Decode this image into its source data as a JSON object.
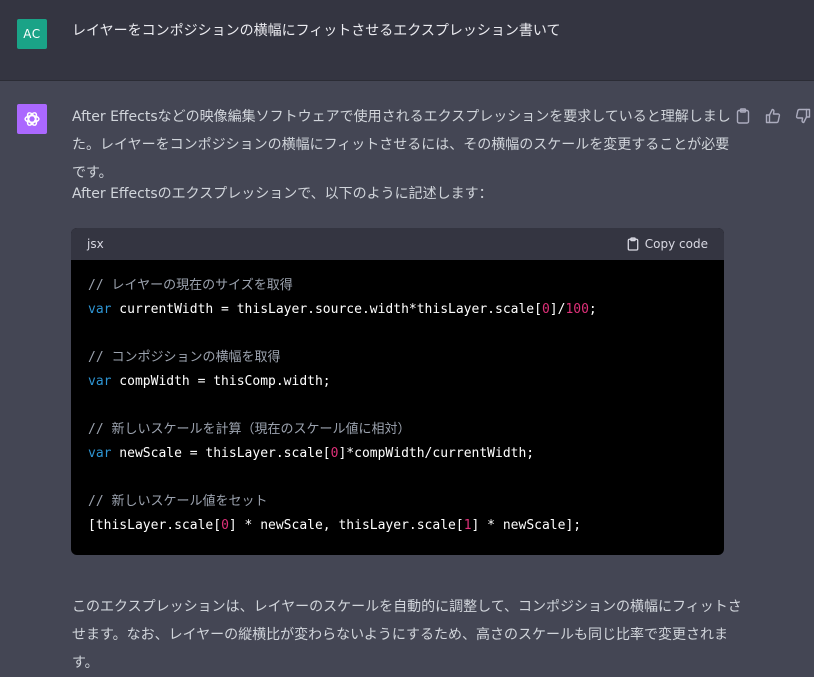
{
  "user": {
    "avatar_initials": "AC",
    "message": "レイヤーをコンポジションの横幅にフィットさせるエクスプレッション書いて"
  },
  "assistant": {
    "paragraph1": "After Effectsなどの映像編集ソフトウェアで使用されるエクスプレッションを要求していると理解しました。レイヤーをコンポジションの横幅にフィットさせるには、その横幅のスケールを変更することが必要です。",
    "paragraph2": "After Effectsのエクスプレッションで、以下のように記述します：",
    "paragraph3": "このエクスプレッションは、レイヤーのスケールを自動的に調整して、コンポジションの横幅にフィットさせます。なお、レイヤーの縦横比が変わらないようにするため、高さのスケールも同じ比率で変更されます。",
    "code": {
      "language": "jsx",
      "copy_label": "Copy code",
      "lines": [
        [
          {
            "t": "cm",
            "v": "// レイヤーの現在のサイズを取得"
          }
        ],
        [
          {
            "t": "kw",
            "v": "var"
          },
          {
            "t": "",
            "v": " currentWidth = thisLayer.source.width*thisLayer.scale["
          },
          {
            "t": "num",
            "v": "0"
          },
          {
            "t": "",
            "v": "]/"
          },
          {
            "t": "num",
            "v": "100"
          },
          {
            "t": "",
            "v": ";"
          }
        ],
        [],
        [
          {
            "t": "cm",
            "v": "// コンポジションの横幅を取得"
          }
        ],
        [
          {
            "t": "kw",
            "v": "var"
          },
          {
            "t": "",
            "v": " compWidth = thisComp.width;"
          }
        ],
        [],
        [
          {
            "t": "cm",
            "v": "// 新しいスケールを計算（現在のスケール値に相対）"
          }
        ],
        [
          {
            "t": "kw",
            "v": "var"
          },
          {
            "t": "",
            "v": " newScale = thisLayer.scale["
          },
          {
            "t": "num",
            "v": "0"
          },
          {
            "t": "",
            "v": "]*compWidth/currentWidth;"
          }
        ],
        [],
        [
          {
            "t": "cm",
            "v": "// 新しいスケール値をセット"
          }
        ],
        [
          {
            "t": "",
            "v": "[thisLayer.scale["
          },
          {
            "t": "num",
            "v": "0"
          },
          {
            "t": "",
            "v": "] * newScale, thisLayer.scale["
          },
          {
            "t": "num",
            "v": "1"
          },
          {
            "t": "",
            "v": "] * newScale];"
          }
        ]
      ]
    }
  },
  "icons": {
    "assistant_logo": "openai-logo-icon",
    "copy_message": "clipboard-icon",
    "thumbs_up": "thumbs-up-icon",
    "thumbs_down": "thumbs-down-icon",
    "copy_code": "clipboard-icon"
  },
  "colors": {
    "user_avatar": "#1aa387",
    "assistant_avatar": "#ab68ff",
    "keyword": "#2e95d3",
    "number": "#df3079",
    "comment": "#9ca3af"
  }
}
